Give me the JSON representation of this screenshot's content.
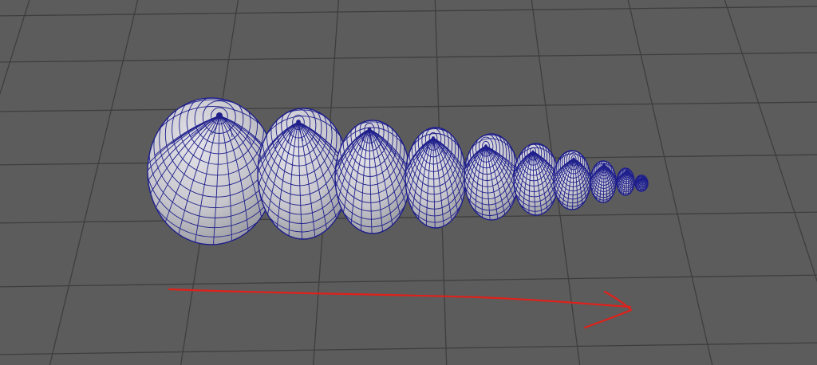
{
  "viewport": {
    "background_color": "#5c5c5c",
    "grid_color": "#3e3e3e",
    "mesh_fill_color": "#c9c9cf",
    "mesh_wire_color": "#1f1f8c",
    "annotation_color": "#e0201a"
  },
  "scene": {
    "object_type": "chain of decreasing polygon spheres",
    "sphere_count": 10,
    "display_mode": "wireframe-on-shaded"
  },
  "annotation": {
    "shape": "freehand arrow",
    "direction": "right"
  }
}
